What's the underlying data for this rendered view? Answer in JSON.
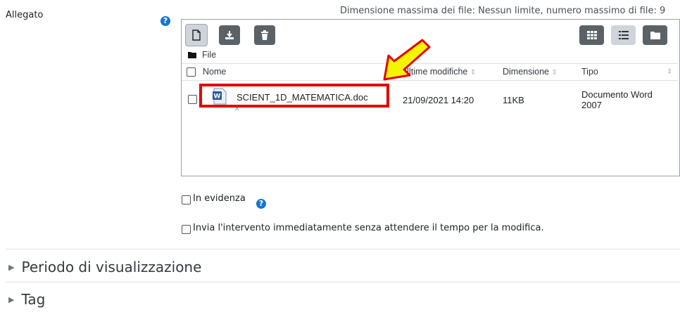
{
  "form": {
    "attachment_label": "Allegato",
    "limits_text": "Dimensione massima dei file: Nessun limite, numero massimo di file: 9"
  },
  "filemanager": {
    "breadcrumb": "File",
    "columns": {
      "name": "Nome",
      "modified": "Ultime modifiche",
      "size": "Dimensione",
      "type": "Tipo"
    },
    "files": [
      {
        "name": "SCIENT_1D_MATEMATICA.doc",
        "modified": "21/09/2021 14:20",
        "size": "11KB",
        "type_line1": "Documento Word",
        "type_line2": "2007",
        "delete_mark": "x"
      }
    ],
    "icons": {
      "add": "file-add-icon",
      "download": "download-icon",
      "delete": "trash-icon",
      "view_grid": "grid-view-icon",
      "view_list": "list-view-icon",
      "view_tree": "folder-view-icon",
      "folder": "folder-icon",
      "file": "word-document-icon"
    }
  },
  "options": {
    "pinned_label": "In evidenza",
    "send_now_label": "Invia l'intervento immediatamente senza attendere il tempo per la modifica."
  },
  "sections": {
    "display_period": "Periodo di visualizzazione",
    "tags": "Tag"
  },
  "annotation": {
    "highlight_color": "#e60000",
    "arrow_color": "#f5f500"
  }
}
